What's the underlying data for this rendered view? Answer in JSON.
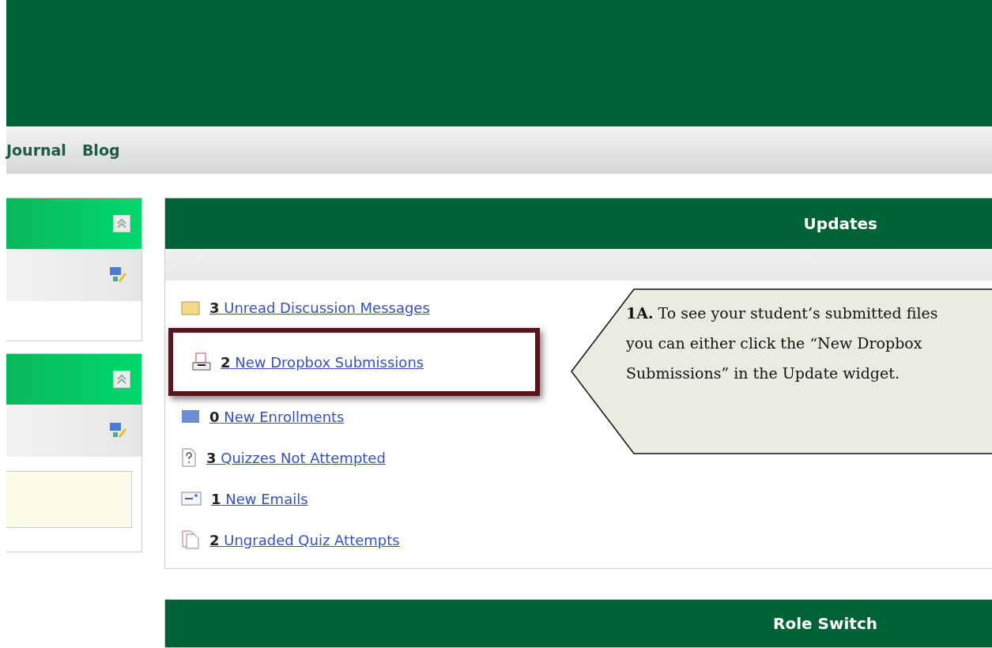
{
  "nav": {
    "items": [
      "Journal",
      "Blog"
    ]
  },
  "left_widgets": [
    {
      "kind": "plain"
    },
    {
      "kind": "note"
    }
  ],
  "updates": {
    "title": "Updates",
    "items": [
      {
        "kind": "discussion",
        "count": "3",
        "label": "Unread Discussion Messages",
        "selected": false
      },
      {
        "kind": "dropbox",
        "count": "2",
        "label": "New Dropbox Submissions",
        "selected": true
      },
      {
        "kind": "enrollment",
        "count": "0",
        "label": "New Enrollments",
        "selected": false
      },
      {
        "kind": "quiz",
        "count": "3",
        "label": "Quizzes Not Attempted",
        "selected": false
      },
      {
        "kind": "email",
        "count": "1",
        "label": "New Emails",
        "selected": false
      },
      {
        "kind": "ungraded",
        "count": "2",
        "label": "Ungraded Quiz Attempts",
        "selected": false
      }
    ]
  },
  "callout": {
    "text": "**1A.** To see your student’s submitted files you can either click the “New Dropbox Submissions” in the Update widget."
  },
  "role_switch": {
    "title": "Role Switch"
  }
}
